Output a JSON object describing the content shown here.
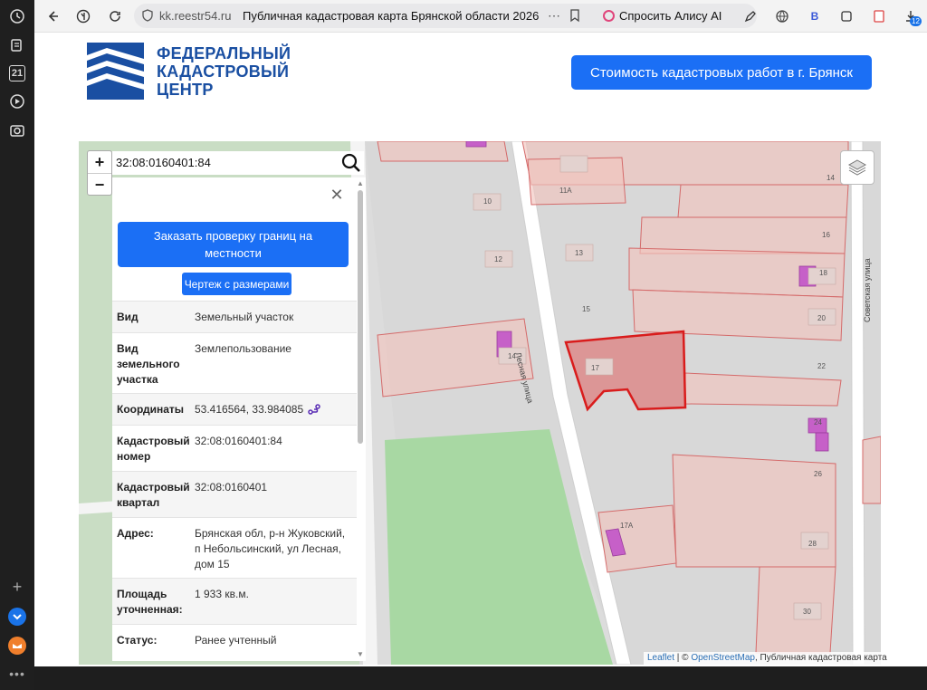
{
  "browser": {
    "url_domain": "kk.reestr54.ru",
    "tab_title": "Публичная кадастровая карта Брянской области 2026",
    "alice_label": "Спросить Алису AI",
    "rail_calendar_day": "21",
    "downloads_badge": "12",
    "ext_letter": "B"
  },
  "header": {
    "logo_line1": "ФЕДЕРАЛЬНЫЙ",
    "logo_line2": "КАДАСТРОВЫЙ",
    "logo_line3": "ЦЕНТР",
    "cta_label": "Стоимость кадастровых работ в г. Брянск"
  },
  "map": {
    "search_value": "32:08:0160401:84",
    "zoom_in": "+",
    "zoom_out": "−",
    "street_lesnaya": "Лесная улица",
    "street_sovetskaya": "Советская улица",
    "labels": [
      "10",
      "12",
      "14",
      "13",
      "15",
      "17",
      "11А",
      "14",
      "16",
      "18",
      "20",
      "22",
      "24",
      "26",
      "17А",
      "28",
      "30"
    ],
    "attribution_leaflet": "Leaflet",
    "attribution_sep": " | © ",
    "attribution_osm": "OpenStreetMap",
    "attribution_rest": ", Публичная кадастровая карта",
    "colors": {
      "selected": "#d91c1c",
      "parcel_fill": "#f1c4bf",
      "building": "#c660c8",
      "forest": "#a8d8a3"
    }
  },
  "panel": {
    "btn_check": "Заказать проверку границ на местности",
    "btn_plan": "Чертеж с размерами",
    "rows": [
      {
        "k": "Вид",
        "v": "Земельный участок"
      },
      {
        "k": "Вид земельного участка",
        "v": "Землепользование"
      },
      {
        "k": "Координаты",
        "v": "53.416564, 33.984085"
      },
      {
        "k": "Кадастровый номер",
        "v": "32:08:0160401:84"
      },
      {
        "k": "Кадастровый квартал",
        "v": "32:08:0160401"
      },
      {
        "k": "Адрес:",
        "v": "Брянская обл, р-н Жуковский, п Небольсинский, ул Лесная, дом 15"
      },
      {
        "k": "Площадь уточненная:",
        "v": "1 933 кв.м."
      },
      {
        "k": "Статус:",
        "v": "Ранее учтенный"
      }
    ]
  }
}
